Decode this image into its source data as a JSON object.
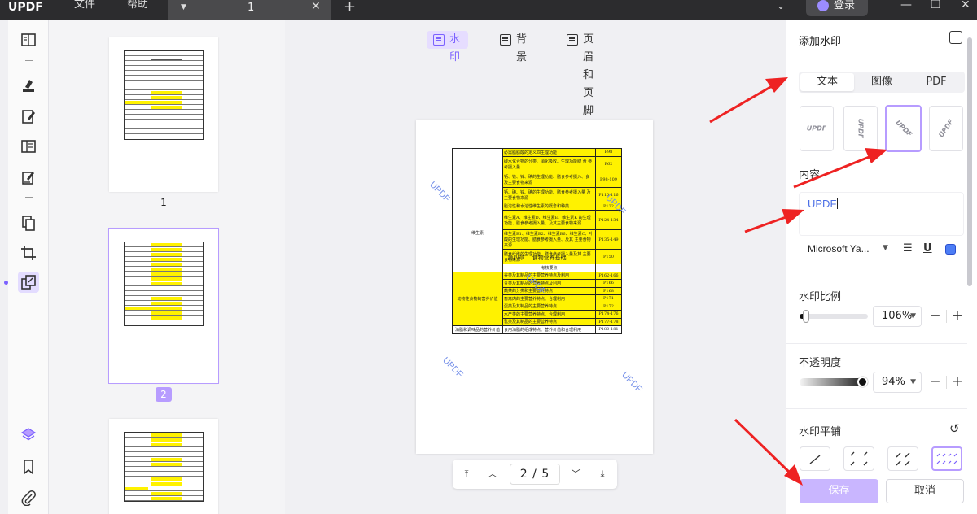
{
  "titlebar": {
    "logo": "UPDF",
    "menu_file": "文件",
    "menu_help": "帮助",
    "tab_title": "1",
    "login": "登录"
  },
  "thumbnails": [
    {
      "label": "1"
    },
    {
      "label": "2"
    }
  ],
  "watermark_tabs": {
    "watermark": "水印",
    "background": "背景",
    "header_footer": "页眉和页脚"
  },
  "page_doc": {
    "watermark_text": "UPDF",
    "rows": [
      {
        "text": "必需脂肪酸的定义四生理功能",
        "ref": "P98"
      },
      {
        "text": "碳水化合物的分类、消化吸收、生理功能膳 食 参考摄入量",
        "ref": "P62"
      },
      {
        "text": "钙、铁、锌、碘的生理功能、膳食参考摄入、食 及主要食物来源",
        "ref": "P98-109"
      },
      {
        "text": "钙、碘、锌、碘的生理功能、膳食参考摄入量 及主要食物来源",
        "ref": "P110-116"
      },
      {
        "text": "脂溶性和水溶性维生素的概念和种类",
        "ref": "P122"
      },
      {
        "text": "维生素A、维生素D、维生素E、维生素K 的生理功能、膳食参考摄入量、及其主要食物来源",
        "ref": "P124-134"
      },
      {
        "text": "维生素B1、维生素B2、维生素B6、维生素C、叶酸的生理功能、膳食参考摄入量、及其 主要食物来源",
        "ref": "P135-149"
      },
      {
        "text": "膳食纤维的生理功能、膳食参考摄入量及其 主要食物来源",
        "ref": "P150"
      }
    ],
    "group_label": "维生素",
    "chapter": "第四章　 食物营养基础",
    "sub_header": "考核要点",
    "rows2": [
      {
        "text": "谷类及其制品的主要营养特点及利用",
        "ref": "P162-166"
      },
      {
        "text": "豆类及其制品的营养特点及利用",
        "ref": "P166"
      },
      {
        "text": "蔬菜的分类和主要营养特点",
        "ref": "P168"
      },
      {
        "text": "畜禽肉的主要营养特点、合理利用",
        "ref": "P171"
      },
      {
        "text": "蛋类及其制品的主要营养特点",
        "ref": "P172"
      },
      {
        "text": "水产类的主要营养特点、合理利用",
        "ref": "P174-176"
      },
      {
        "text": "乳类及其制品的主要营养特点",
        "ref": "P177-178"
      }
    ],
    "group2_label": "动物性食物的营养价值",
    "last_left": "油脂和调味品的营养价值",
    "last_mid": "食用油脂的组成特点、营养价值和合理利用",
    "last_ref": "P180-181"
  },
  "pager": {
    "current": "2",
    "separator": "/",
    "total": "5"
  },
  "panel": {
    "title": "添加水印",
    "type_tabs": [
      "文本",
      "图像",
      "PDF"
    ],
    "style_preview": "UPDF",
    "content_label": "内容",
    "content_value": "UPDF",
    "font_name": "Microsoft Ya...",
    "scale_label": "水印比例",
    "scale_value": "106%",
    "scale_fraction": 0.1,
    "opacity_label": "不透明度",
    "opacity_value": "94%",
    "opacity_fraction": 0.94,
    "tile_label": "水印平铺",
    "save": "保存",
    "cancel": "取消"
  },
  "colors": {
    "accent": "#7b61ff",
    "watermark_text": "#6f8be8",
    "highlight": "#fff200",
    "annotation_arrow": "#ee2222"
  }
}
